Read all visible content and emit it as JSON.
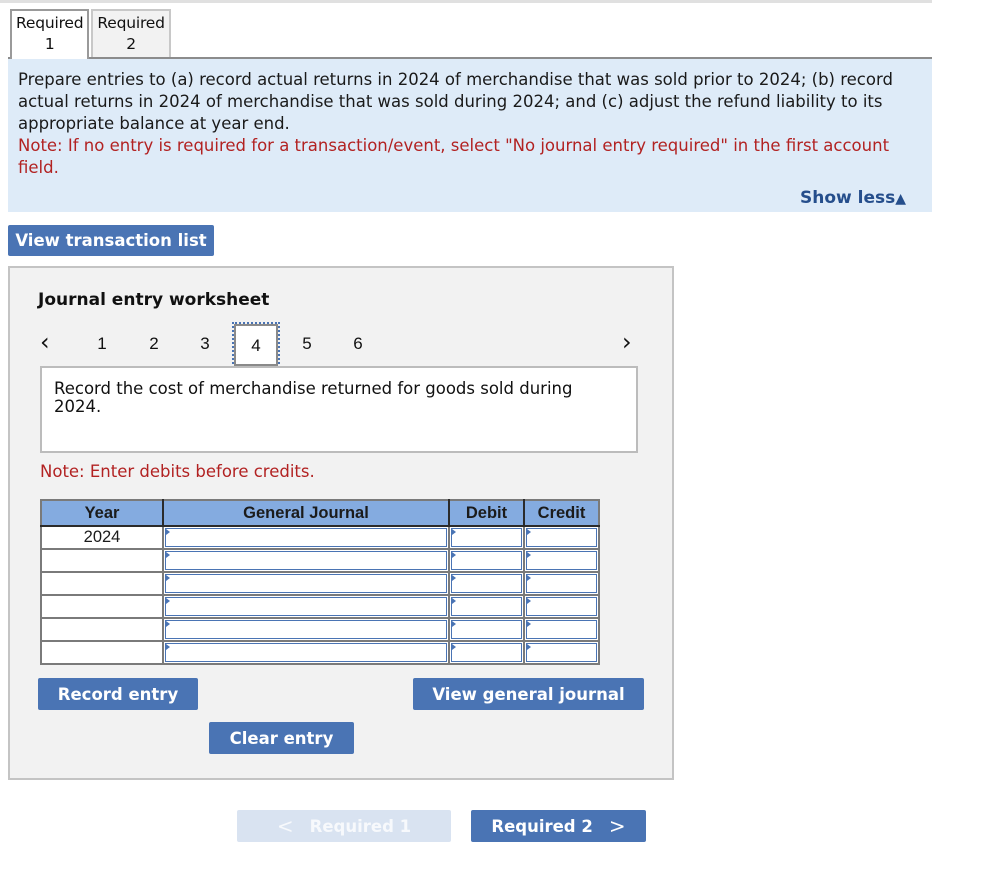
{
  "tabs": [
    {
      "line1": "Required",
      "line2": "1",
      "active": true
    },
    {
      "line1": "Required",
      "line2": "2",
      "active": false
    }
  ],
  "instructions": {
    "main": "Prepare entries to (a) record actual returns in 2024 of merchandise that was sold prior to 2024; (b) record actual returns in 2024 of merchandise that was sold during 2024; and (c) adjust the refund liability to its appropriate balance at year end.",
    "note": "Note: If no entry is required for a transaction/event, select \"No journal entry required\" in the first account field.",
    "show_less_label": "Show less",
    "show_less_icon": "▲"
  },
  "view_transaction_list_label": "View transaction list",
  "worksheet": {
    "title": "Journal entry worksheet",
    "pager": {
      "prev_icon": "‹",
      "next_icon": "›",
      "pages": [
        "1",
        "2",
        "3",
        "4",
        "5",
        "6"
      ],
      "current": "4"
    },
    "description": "Record the cost of merchandise returned for goods sold during 2024.",
    "note": "Note: Enter debits before credits.",
    "table": {
      "headers": [
        "Year",
        "General Journal",
        "Debit",
        "Credit"
      ],
      "rows": [
        {
          "year": "2024",
          "account": "",
          "debit": "",
          "credit": ""
        },
        {
          "year": "",
          "account": "",
          "debit": "",
          "credit": ""
        },
        {
          "year": "",
          "account": "",
          "debit": "",
          "credit": ""
        },
        {
          "year": "",
          "account": "",
          "debit": "",
          "credit": ""
        },
        {
          "year": "",
          "account": "",
          "debit": "",
          "credit": ""
        },
        {
          "year": "",
          "account": "",
          "debit": "",
          "credit": ""
        }
      ]
    },
    "buttons": {
      "record": "Record entry",
      "clear": "Clear entry",
      "view_general_journal": "View general journal"
    }
  },
  "nav": {
    "prev_label": "Required 1",
    "prev_icon": "<",
    "prev_enabled": false,
    "next_label": "Required 2",
    "next_icon": ">"
  },
  "colors": {
    "button_blue": "#4a74b4",
    "instructions_bg": "#deebf8",
    "note_red": "#b22222",
    "header_blue": "#84abe0"
  }
}
